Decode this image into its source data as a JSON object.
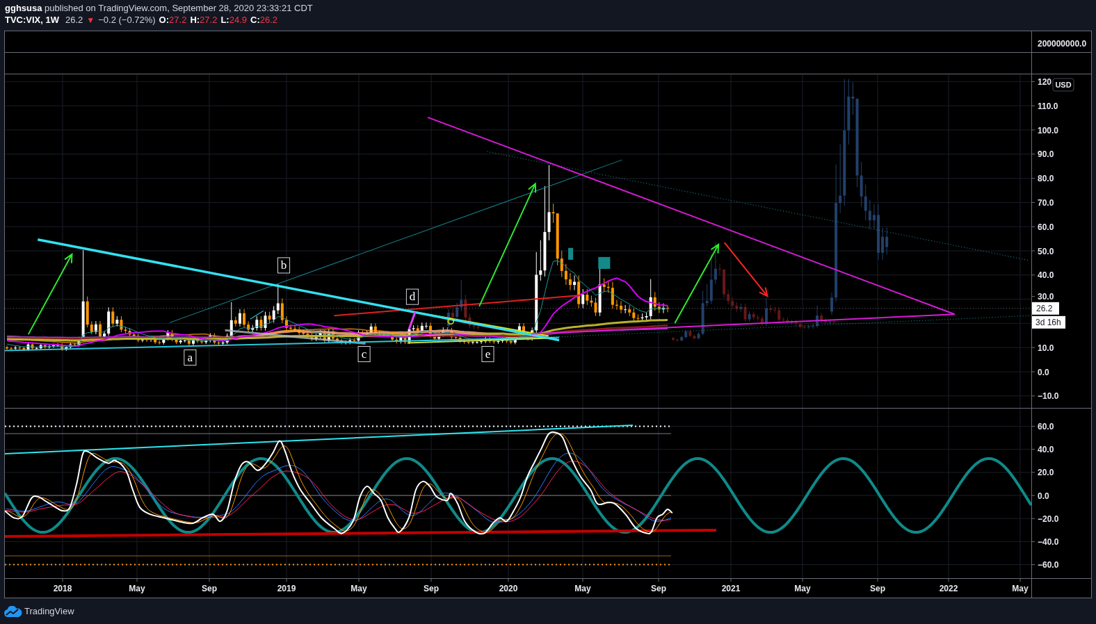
{
  "header": {
    "byline": "**gghsusa** published on TradingView.com, September 28, 2020 23:33:21 CDT",
    "symbol": "TVC:VIX, 1W",
    "last": "26.2",
    "falling": true,
    "change_icon": "▼",
    "change": "−0.2 (−0.72%)",
    "ohlc": [
      {
        "label": "O:",
        "value": "27.2"
      },
      {
        "label": "H:",
        "value": "27.2"
      },
      {
        "label": "L:",
        "value": "24.9"
      },
      {
        "label": "C:",
        "value": "26.2"
      }
    ]
  },
  "volume_pane": {
    "axis_labels": [
      "200000000.0"
    ]
  },
  "price_pane": {
    "currency": "USD",
    "axis_labels": [
      "120",
      "110.0",
      "100.0",
      "90.0",
      "80.0",
      "70.0",
      "60.0",
      "50.0",
      "40.0",
      "30.0",
      "10.0",
      "0.0",
      "−10.0"
    ],
    "last_price": "26.2",
    "countdown": "3d 16h",
    "wave_labels": [
      "a",
      "b",
      "c",
      "d",
      "e"
    ]
  },
  "oscillator_pane": {
    "axis_labels": [
      "60.0",
      "40.0",
      "20.0",
      "0.0",
      "−20.0",
      "−40.0",
      "−60.0"
    ]
  },
  "time_axis": {
    "labels": [
      "2018",
      "May",
      "Sep",
      "2019",
      "May",
      "Sep",
      "2020",
      "May",
      "Sep",
      "2021",
      "May",
      "Sep",
      "2022",
      "May"
    ]
  },
  "footer": {
    "brand": "TradingView"
  }
}
